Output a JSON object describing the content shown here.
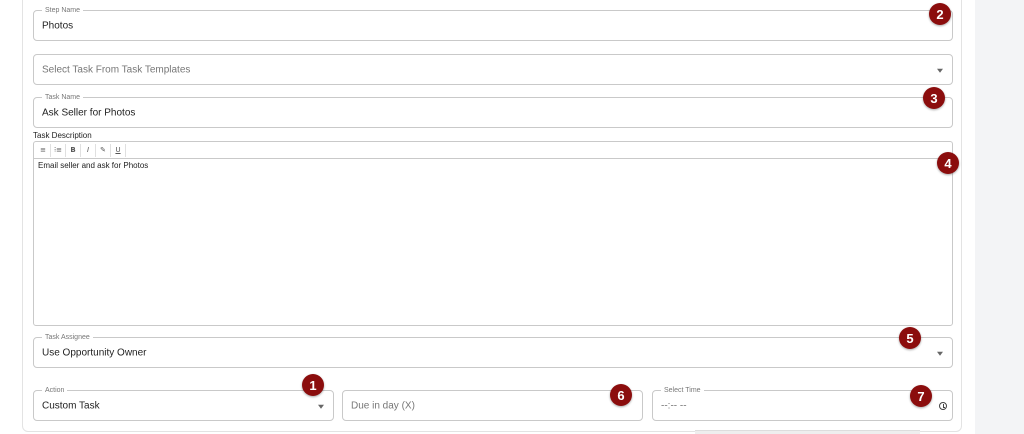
{
  "step": {
    "label": "Step Name",
    "value": "Photos"
  },
  "template_select": {
    "placeholder": "Select Task From Task Templates"
  },
  "task_name": {
    "label": "Task Name",
    "value": "Ask Seller for Photos"
  },
  "description": {
    "label": "Task Description",
    "toolbar": {
      "bulleted": "≡",
      "numbered": "⁝≡",
      "bold": "B",
      "italic": "I",
      "link": "✎",
      "underline": "U"
    },
    "content": "Email seller and ask for Photos"
  },
  "assignee": {
    "label": "Task Assignee",
    "value": "Use Opportunity Owner"
  },
  "action": {
    "label": "Action",
    "value": "Custom Task"
  },
  "due": {
    "placeholder": "Due in day (X)"
  },
  "time": {
    "label": "Select Time",
    "value": "--:-- --"
  },
  "badges": {
    "b1": "1",
    "b2": "2",
    "b3": "3",
    "b4": "4",
    "b5": "5",
    "b6": "6",
    "b7": "7"
  },
  "colors": {
    "badge": "#8b0d0d",
    "border": "#c9c9c9"
  }
}
